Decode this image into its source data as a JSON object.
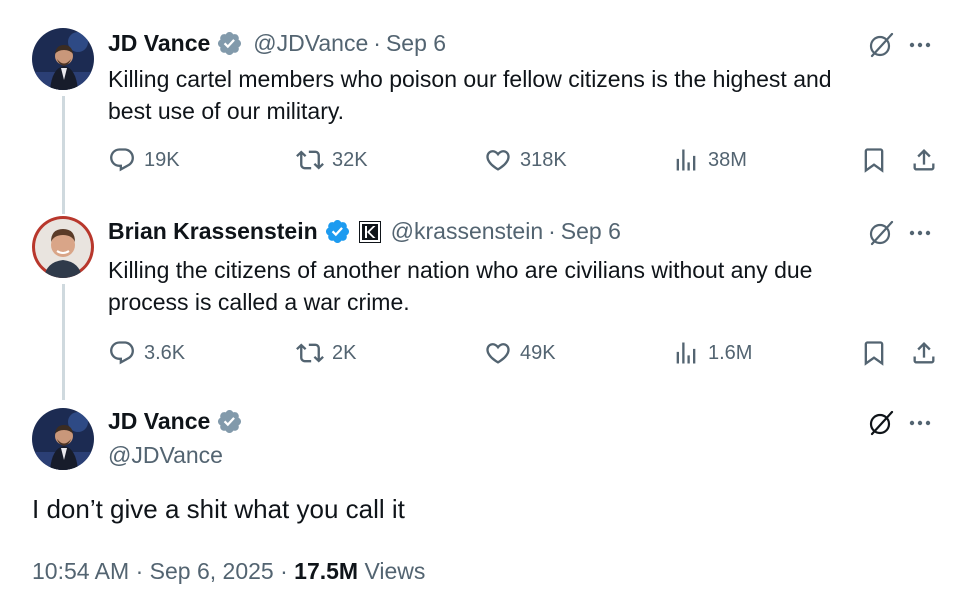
{
  "tweets": [
    {
      "name": "JD Vance",
      "handle": "@JDVance",
      "date": "Sep 6",
      "text_line1": "Killing cartel members who poison our fellow citizens is the highest and",
      "text_line2": "best use of our military.",
      "replies": "19K",
      "retweets": "32K",
      "likes": "318K",
      "views": "38M"
    },
    {
      "name": "Brian Krassenstein",
      "handle": "@krassenstein",
      "date": "Sep 6",
      "text_line1": "Killing the citizens of another nation who are civilians without any due",
      "text_line2": "process is called a war crime.",
      "replies": "3.6K",
      "retweets": "2K",
      "likes": "49K",
      "views": "1.6M"
    }
  ],
  "main_tweet": {
    "name": "JD Vance",
    "handle": "@JDVance",
    "text": "I don’t give a shit what you call it",
    "time": "10:54 AM",
    "date": "Sep 6, 2025",
    "views_count": "17.5M",
    "views_label": "Views"
  },
  "separator": "·",
  "icons": {
    "verified": "verified-badge-icon",
    "grok": "grok-icon",
    "more": "more-icon",
    "reply": "reply-icon",
    "retweet": "retweet-icon",
    "like": "heart-icon",
    "views": "views-icon",
    "bookmark": "bookmark-icon",
    "share": "share-icon"
  },
  "colors": {
    "verified_gray": "#829aab",
    "verified_blue": "#1d9bf0",
    "text_primary": "#0f1419",
    "text_secondary": "#536471",
    "thread_line": "#cfd9de"
  }
}
